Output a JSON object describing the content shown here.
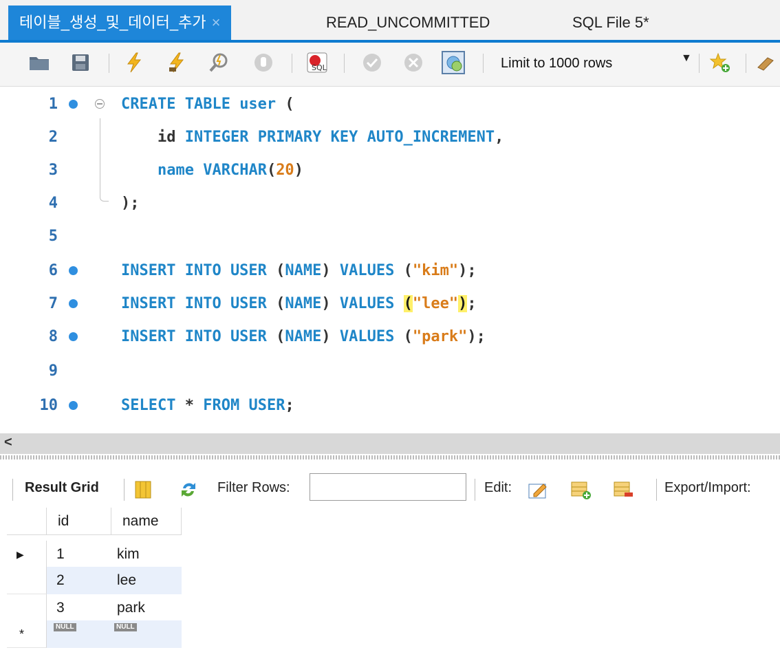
{
  "tabs": [
    {
      "label": "테이블_생성_및_데이터_추가",
      "active": true,
      "close": "×"
    },
    {
      "label": "READ_UNCOMMITTED",
      "active": false
    },
    {
      "label": "SQL File 5*",
      "active": false
    }
  ],
  "toolbar": {
    "limit_label": "Limit to 1000 rows",
    "icons": [
      "open-folder-icon",
      "save-icon",
      "execute-lightning-icon",
      "execute-current-icon",
      "explain-magnifier-icon",
      "stop-icon",
      "toggle-error-icon",
      "commit-icon",
      "rollback-icon",
      "autocommit-icon",
      "dropdown-arrow-icon",
      "bookmark-star-icon"
    ]
  },
  "editor": {
    "lines": [
      {
        "num": "1",
        "dot": true,
        "fold": true,
        "tokens": [
          {
            "t": "CREATE TABLE ",
            "c": "kw"
          },
          {
            "t": "user",
            "c": "kw"
          },
          {
            "t": " (",
            "c": "id"
          }
        ]
      },
      {
        "num": "2",
        "dot": false,
        "tokens": [
          {
            "t": "    ",
            "c": "id"
          },
          {
            "t": "id ",
            "c": "id"
          },
          {
            "t": "INTEGER PRIMARY KEY AUTO_INCREMENT",
            "c": "kw"
          },
          {
            "t": ",",
            "c": "id"
          }
        ]
      },
      {
        "num": "3",
        "dot": false,
        "tokens": [
          {
            "t": "    ",
            "c": "id"
          },
          {
            "t": "name ",
            "c": "kw"
          },
          {
            "t": "VARCHAR",
            "c": "kw"
          },
          {
            "t": "(",
            "c": "id"
          },
          {
            "t": "20",
            "c": "num"
          },
          {
            "t": ")",
            "c": "id"
          }
        ]
      },
      {
        "num": "4",
        "dot": false,
        "tokens": [
          {
            "t": ");",
            "c": "id"
          }
        ]
      },
      {
        "num": "5",
        "dot": false,
        "tokens": []
      },
      {
        "num": "6",
        "dot": true,
        "tokens": [
          {
            "t": "INSERT INTO USER ",
            "c": "kw"
          },
          {
            "t": "(",
            "c": "id"
          },
          {
            "t": "NAME",
            "c": "kw"
          },
          {
            "t": ") ",
            "c": "id"
          },
          {
            "t": "VALUES ",
            "c": "kw"
          },
          {
            "t": "(",
            "c": "id"
          },
          {
            "t": "\"kim\"",
            "c": "str"
          },
          {
            "t": ");",
            "c": "id"
          }
        ]
      },
      {
        "num": "7",
        "dot": true,
        "tokens": [
          {
            "t": "INSERT INTO USER ",
            "c": "kw"
          },
          {
            "t": "(",
            "c": "id"
          },
          {
            "t": "NAME",
            "c": "kw"
          },
          {
            "t": ") ",
            "c": "id"
          },
          {
            "t": "VALUES ",
            "c": "kw"
          },
          {
            "t": "(",
            "c": "hl"
          },
          {
            "t": "\"lee\"",
            "c": "str"
          },
          {
            "t": ")",
            "c": "hl"
          },
          {
            "t": ";",
            "c": "id"
          }
        ]
      },
      {
        "num": "8",
        "dot": true,
        "tokens": [
          {
            "t": "INSERT INTO USER ",
            "c": "kw"
          },
          {
            "t": "(",
            "c": "id"
          },
          {
            "t": "NAME",
            "c": "kw"
          },
          {
            "t": ") ",
            "c": "id"
          },
          {
            "t": "VALUES ",
            "c": "kw"
          },
          {
            "t": "(",
            "c": "id"
          },
          {
            "t": "\"park\"",
            "c": "str"
          },
          {
            "t": ");",
            "c": "id"
          }
        ]
      },
      {
        "num": "9",
        "dot": false,
        "tokens": []
      },
      {
        "num": "10",
        "dot": true,
        "tokens": [
          {
            "t": "SELECT ",
            "c": "kw"
          },
          {
            "t": "* ",
            "c": "id"
          },
          {
            "t": "FROM ",
            "c": "kw"
          },
          {
            "t": "USER",
            "c": "kw"
          },
          {
            "t": ";",
            "c": "id"
          }
        ]
      }
    ]
  },
  "scroll": {
    "left_arrow": "<"
  },
  "result_toolbar": {
    "result_grid_label": "Result Grid",
    "filter_label": "Filter Rows:",
    "filter_value": "",
    "edit_label": "Edit:",
    "export_label": "Export/Import:"
  },
  "grid": {
    "columns": [
      "id",
      "name"
    ],
    "rows": [
      {
        "marker": "▶",
        "id": "1",
        "name": "kim"
      },
      {
        "marker": "",
        "id": "2",
        "name": "lee"
      },
      {
        "marker": "",
        "id": "3",
        "name": "park"
      }
    ],
    "new_row": {
      "marker": "*",
      "id": "NULL",
      "name": "NULL"
    }
  },
  "colors": {
    "accent": "#1e86d9",
    "keyword": "#1f86c8",
    "string": "#d97c1a",
    "line_number": "#2e6fb0",
    "bracket_highlight": "#fff06a"
  }
}
